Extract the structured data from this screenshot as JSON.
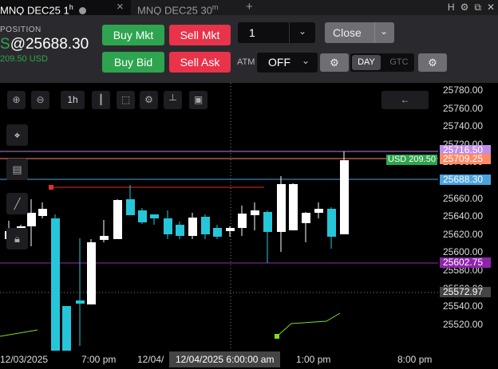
{
  "tabs": [
    {
      "label": "MNQ DEC25 1",
      "sup": "h",
      "close": "×"
    },
    {
      "label": "MNQ DEC25 30",
      "sup": "m",
      "close": "+"
    }
  ],
  "tabbar_icons": [
    "H",
    "⚙",
    "⧉",
    "✕"
  ],
  "position": {
    "label": "POSITION",
    "prefix": "S",
    "price": "@25688.30",
    "pnl": "209.50 USD"
  },
  "order": {
    "buy_mkt": "Buy Mkt",
    "sell_mkt": "Sell Mkt",
    "buy_bid": "Buy Bid",
    "sell_ask": "Sell Ask",
    "qty": "1",
    "close": "Close",
    "atm_label": "ATM",
    "atm_value": "OFF",
    "tif_day": "DAY",
    "tif_gtc": "GTC"
  },
  "toolbar": {
    "interval": "1h"
  },
  "price_axis": {
    "ticks": [
      "25780.00",
      "25760.00",
      "25740.00",
      "25720.00",
      "25700.00",
      "25680.00",
      "25660.00",
      "25640.00",
      "25620.00",
      "25600.00",
      "25580.00",
      "25560.00",
      "25540.00",
      "25520.00"
    ],
    "labels": {
      "purple_top": "25716.50",
      "orange": "25709.25",
      "blue": "25688.30",
      "purple_bottom": "25602.75",
      "gray": "25572.97"
    },
    "pnl_tag": "USD 209.50"
  },
  "time_axis": {
    "labels": [
      "12/03/2025",
      "7:00 pm",
      "12/04/",
      "1:00 pm",
      "8:00 pm"
    ],
    "crosshair": "12/04/2025 6:00:00 am"
  },
  "colors": {
    "up": "#ffffff",
    "down": "#26c6da",
    "buy": "#2ea44f",
    "sell": "#e8334a",
    "purple": "#9c27b0",
    "orange": "#ff8a65",
    "blue": "#4aa3df",
    "line": "#7cdc1f"
  }
}
